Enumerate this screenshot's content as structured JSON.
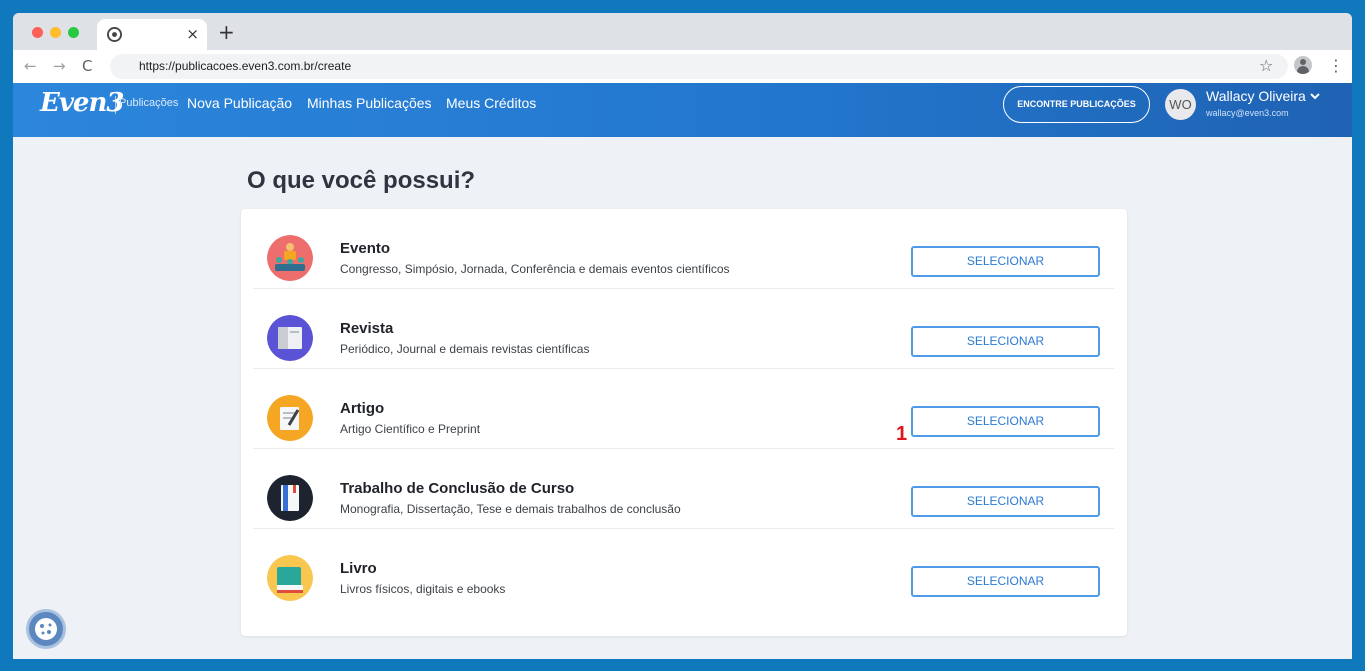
{
  "browser": {
    "tab_close": "×",
    "new_tab": "+",
    "url": "https://publicacoes.even3.com.br/create",
    "nav_back": "←",
    "nav_forward": "→",
    "nav_reload": "C",
    "star": "☆",
    "menu": "⋮"
  },
  "header": {
    "logo": "Even3",
    "logo_sub": "Publicações",
    "nav": [
      "Nova Publicação",
      "Minhas Publicações",
      "Meus Créditos"
    ],
    "find_button": "ENCONTRE PUBLICAÇÕES",
    "avatar_initials": "WO",
    "user_name": "Wallacy Oliveira",
    "user_email": "wallacy@even3.com"
  },
  "main": {
    "title": "O que você possui?",
    "items": [
      {
        "title": "Evento",
        "desc": "Congresso, Simpósio, Jornada, Conferência e demais eventos científicos",
        "button": "SELECIONAR",
        "icon": "event-icon",
        "color": "#ee6e6e"
      },
      {
        "title": "Revista",
        "desc": "Periódico, Journal e demais revistas científicas",
        "button": "SELECIONAR",
        "icon": "magazine-icon",
        "color": "#5b53d6"
      },
      {
        "title": "Artigo",
        "desc": "Artigo Científico e Preprint",
        "button": "SELECIONAR",
        "icon": "article-icon",
        "color": "#f5a623"
      },
      {
        "title": "Trabalho de Conclusão de Curso",
        "desc": "Monografia, Dissertação, Tese e demais trabalhos de conclusão",
        "button": "SELECIONAR",
        "icon": "thesis-icon",
        "color": "#1e2330"
      },
      {
        "title": "Livro",
        "desc": "Livros físicos, digitais e ebooks",
        "button": "SELECIONAR",
        "icon": "book-icon",
        "color": "#f9c74f"
      }
    ],
    "annotation": "1"
  },
  "colors": {
    "header_blue": "#2580d6",
    "button_blue": "#4f9be6",
    "annotation_red": "#e1141e"
  }
}
